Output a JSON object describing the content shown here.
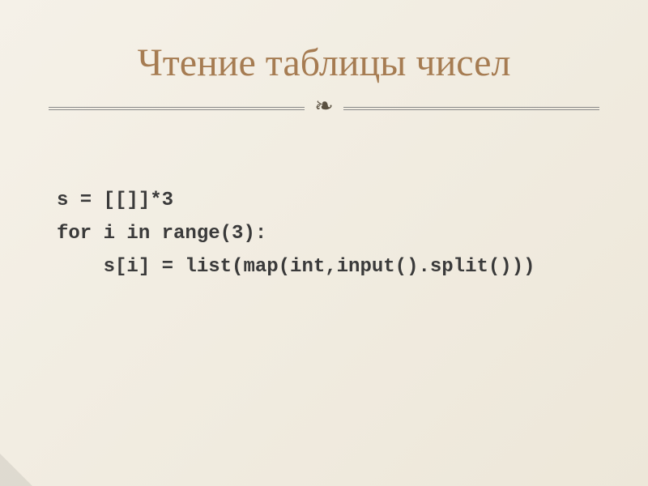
{
  "slide": {
    "title": "Чтение таблицы чисел",
    "ornament": "❧",
    "code": {
      "line1": "s = [[]]*3",
      "line2": "for i in range(3):",
      "line3": "    s[i] = list(map(int,input().split()))"
    }
  }
}
